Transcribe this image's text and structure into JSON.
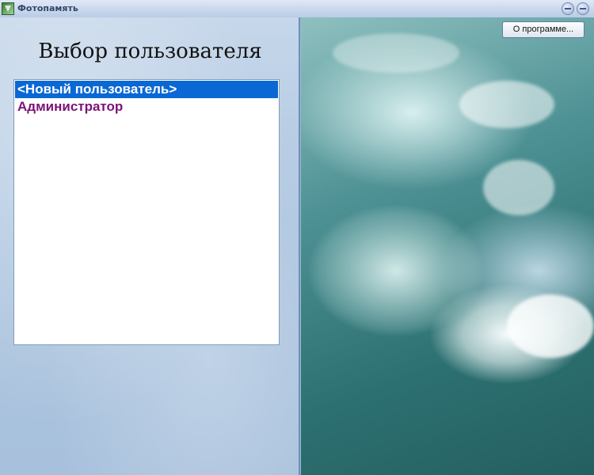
{
  "window": {
    "title": "Фотопамять",
    "icons": [
      "app-icon",
      "minimize-icon",
      "close-icon"
    ]
  },
  "left_panel": {
    "heading": "Выбор пользователя",
    "users": [
      {
        "label": "<Новый пользователь>",
        "selected": true
      },
      {
        "label": "Администратор",
        "selected": false
      }
    ]
  },
  "right_panel": {
    "about_button": "О программе..."
  },
  "colors": {
    "selected_bg": "#0a68d4",
    "user_text": "#7d1278"
  }
}
